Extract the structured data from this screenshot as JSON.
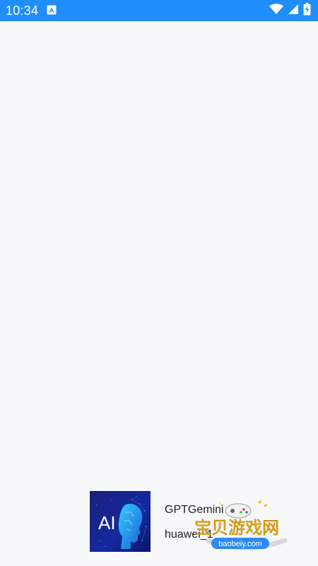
{
  "status_bar": {
    "time": "10:34",
    "notification_icon": "a-letter-icon",
    "icons": [
      "wifi-icon",
      "cell-signal-icon",
      "battery-charging-icon"
    ],
    "color": "#1f8efa"
  },
  "splash": {
    "logo_text": "AI",
    "app_name": "GPTGemini",
    "subtitle": "huawei_1"
  },
  "watermark": {
    "text_cn": "宝贝游戏网",
    "text_url": "baobeiy.com"
  }
}
